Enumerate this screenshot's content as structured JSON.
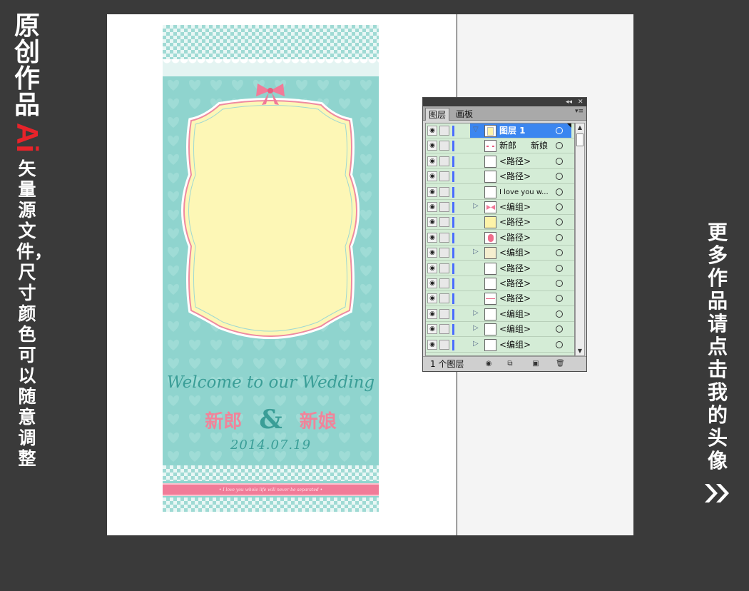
{
  "left_banner": {
    "title": "原创作品",
    "logo": "Ai",
    "subtitle": "矢量源文件，尺寸颜色可以随意调整"
  },
  "right_banner": {
    "text": "更多作品请点击我的头像",
    "arrow_icon": "double-chevron-right-icon"
  },
  "design": {
    "welcome": "Welcome to our Wedding",
    "groom": "新郎",
    "amp": "&",
    "bride": "新娘",
    "date": "2014.07.19",
    "ribbon_text": "• I love you whole life will never be separated •",
    "colors": {
      "teal": "#8fd5cf",
      "cream": "#fdf7b6",
      "pink": "#f0849a",
      "text_teal": "#3a9e97"
    }
  },
  "layers_panel": {
    "tabs": [
      {
        "label": "图层"
      },
      {
        "label": "画板"
      }
    ],
    "rows": [
      {
        "label": "图层 1",
        "label_right": "",
        "expand": "▽",
        "thumb": "layer",
        "selected": true
      },
      {
        "label": "新郎",
        "label_right": "新娘",
        "expand": "",
        "thumb": "text"
      },
      {
        "label": "<路径>",
        "label_right": "",
        "expand": "",
        "thumb": "blank"
      },
      {
        "label": "<路径>",
        "label_right": "",
        "expand": "",
        "thumb": "blank"
      },
      {
        "label": "I love you w...",
        "label_right": "",
        "expand": "",
        "thumb": "blank",
        "small": true
      },
      {
        "label": "<编组>",
        "label_right": "",
        "expand": "▷",
        "thumb": "bow"
      },
      {
        "label": "<路径>",
        "label_right": "",
        "expand": "",
        "thumb": "yellow"
      },
      {
        "label": "<路径>",
        "label_right": "",
        "expand": "",
        "thumb": "pink"
      },
      {
        "label": "<编组>",
        "label_right": "",
        "expand": "▷",
        "thumb": "beige"
      },
      {
        "label": "<路径>",
        "label_right": "",
        "expand": "",
        "thumb": "blank"
      },
      {
        "label": "<路径>",
        "label_right": "",
        "expand": "",
        "thumb": "blank"
      },
      {
        "label": "<路径>",
        "label_right": "",
        "expand": "",
        "thumb": "line"
      },
      {
        "label": "<编组>",
        "label_right": "",
        "expand": "▷",
        "thumb": "blank"
      },
      {
        "label": "<编组>",
        "label_right": "",
        "expand": "▷",
        "thumb": "blank"
      },
      {
        "label": "<编组>",
        "label_right": "",
        "expand": "▷",
        "thumb": "blank"
      }
    ],
    "footer_count": "1 个图层"
  }
}
